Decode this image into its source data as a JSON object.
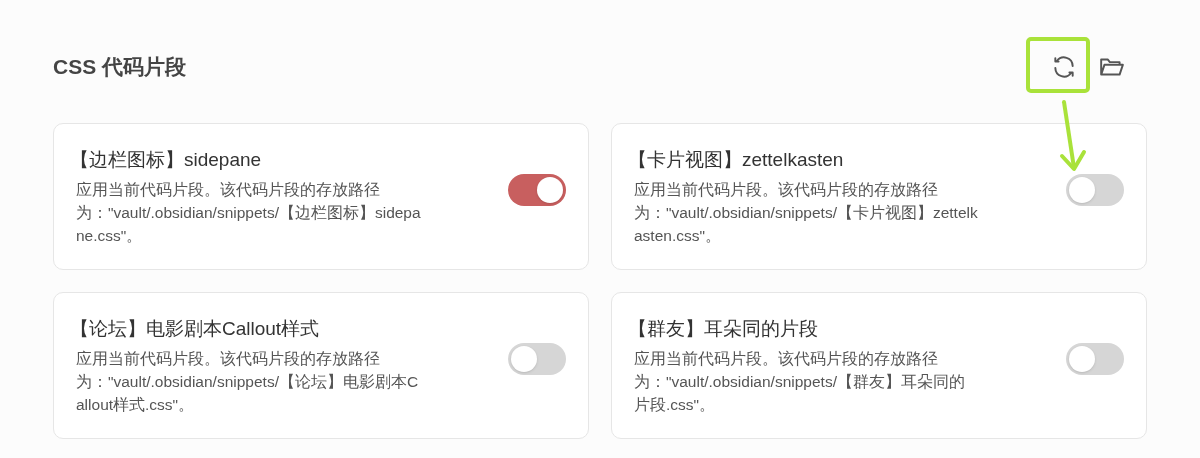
{
  "section": {
    "title": "CSS 代码片段"
  },
  "snippets": [
    {
      "title": "【边栏图标】sidepane",
      "description": "应用当前代码片段。该代码片段的存放路径为：\"vault/.obsidian/snippets/【边栏图标】sidepane.css\"。",
      "on": true
    },
    {
      "title": "【卡片视图】zettelkasten",
      "description": "应用当前代码片段。该代码片段的存放路径为：\"vault/.obsidian/snippets/【卡片视图】zettelkasten.css\"。",
      "on": false
    },
    {
      "title": "【论坛】电影剧本Callout样式",
      "description": "应用当前代码片段。该代码片段的存放路径为：\"vault/.obsidian/snippets/【论坛】电影剧本Callout样式.css\"。",
      "on": false
    },
    {
      "title": "【群友】耳朵同的片段",
      "description": "应用当前代码片段。该代码片段的存放路径为：\"vault/.obsidian/snippets/【群友】耳朵同的片段.css\"。",
      "on": false
    }
  ]
}
